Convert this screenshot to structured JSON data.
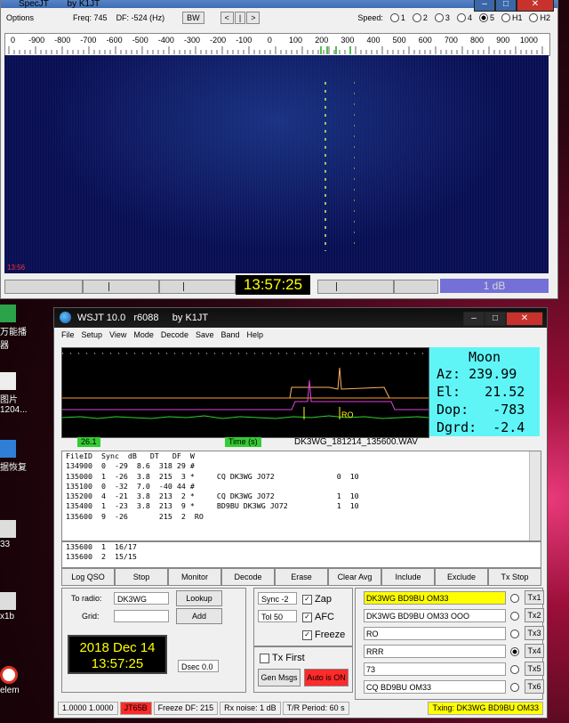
{
  "desktop": {
    "icons": [
      {
        "label": "万能播\n器",
        "color": "#2ba34a"
      },
      {
        "label": "图片\n1204...",
        "color": "#eee"
      },
      {
        "label": "据恢复",
        "color": "#2f7fd6"
      },
      {
        "label": "33",
        "color": "#ddd"
      },
      {
        "label": "x1b",
        "color": "#ddd"
      },
      {
        "label": "elem",
        "color": "#d32"
      }
    ]
  },
  "specjt": {
    "title": "SpecJT",
    "by": "by K1JT",
    "options_label": "Options",
    "freq_label": "Freq: 745",
    "df_label": "DF: -524 (Hz)",
    "bw_label": "BW",
    "nav": [
      "<",
      "|",
      ">"
    ],
    "speed_label": "Speed:",
    "speeds": [
      "1",
      "2",
      "3",
      "4",
      "5",
      "H1",
      "H2"
    ],
    "speed_selected": "5",
    "scale_ticks": [
      "0",
      "-900",
      "-800",
      "-700",
      "-600",
      "-500",
      "-400",
      "-300",
      "-200",
      "-100",
      "0",
      "100",
      "200",
      "300",
      "400",
      "500",
      "600",
      "700",
      "800",
      "900",
      "1000"
    ],
    "time_mark": "13:56",
    "clock": "13:57:25",
    "level": "1 dB"
  },
  "wsjt": {
    "title": "WSJT 10.0   r6088     by K1JT",
    "menu": [
      "File",
      "Setup",
      "View",
      "Mode",
      "Decode",
      "Save",
      "Band",
      "Help"
    ],
    "moon": {
      "title": "Moon",
      "az": "Az: 239.99",
      "el": "El:   21.52",
      "dop": "Dop:   -783",
      "dgrd": "Dgrd:  -2.4"
    },
    "graph_label": "RO",
    "status_left": "26.1",
    "status_time": "Time (s)",
    "wav_file": "DK3WG_181214_135600.WAV",
    "decode_header": "FileID  Sync  dB   DT   DF  W",
    "decodes": [
      "134900  0  -29  8.6  318 29 #",
      "135000  1  -26  3.8  215  3 *     CQ DK3WG JO72              0  10",
      "135100  0  -32  7.0  -40 44 #",
      "135200  4  -21  3.8  213  2 *     CQ DK3WG JO72              1  10",
      "135400  1  -23  3.8  213  9 *     BD9BU DK3WG JO72           1  10",
      "135600  9  -26       215  2  RO"
    ],
    "averages": [
      "135600  1  16/17",
      "135600  2  15/15"
    ],
    "buttons": [
      "Log QSO",
      "Stop",
      "Monitor",
      "Decode",
      "Erase",
      "Clear Avg",
      "Include",
      "Exclude",
      "Tx Stop"
    ],
    "to_radio_label": "To radio:",
    "to_radio": "DK3WG",
    "grid_label": "Grid:",
    "grid": "",
    "lookup": "Lookup",
    "add": "Add",
    "date": "2018 Dec 14",
    "time": "13:57:25",
    "dsec": "Dsec  0.0",
    "sync_label": "Sync  -2",
    "tol_label": "Tol  50",
    "zap": "Zap",
    "afc": "AFC",
    "freeze": "Freeze",
    "txfirst": "Tx First",
    "gen_msgs": "Gen Msgs",
    "auto_is_on": "Auto is ON",
    "messages": [
      "DK3WG BD9BU OM33",
      "DK3WG BD9BU OM33 OOO",
      "RO",
      "RRR",
      "73",
      "CQ BD9BU OM33"
    ],
    "tx_labels": [
      "Tx1",
      "Tx2",
      "Tx3",
      "Tx4",
      "Tx5",
      "Tx6"
    ],
    "tx_selected": 4,
    "statusbar": {
      "freq": "1.0000 1.0000",
      "jt": "JT65B",
      "freeze": "Freeze DF: 215",
      "rx": "Rx noise:  1 dB",
      "tr": "T/R Period: 60 s",
      "txing": "Txing:  DK3WG BD9BU OM33"
    },
    "colors": {
      "moon_bg": "#5ff5f7",
      "highlight": "#ffff00",
      "auto_btn": "#ff2a2a",
      "green": "#33cc33"
    }
  }
}
